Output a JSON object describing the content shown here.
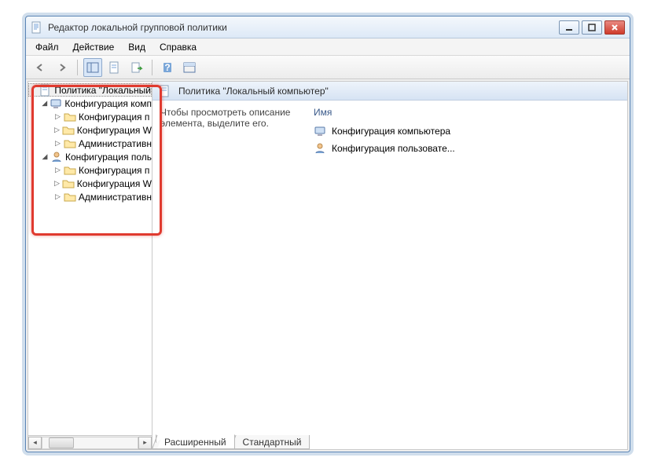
{
  "window": {
    "title": "Редактор локальной групповой политики"
  },
  "menu": {
    "file": "Файл",
    "action": "Действие",
    "view": "Вид",
    "help": "Справка"
  },
  "tree": {
    "root": "Политика \"Локальный",
    "comp_config": "Конфигурация комп",
    "comp_children": {
      "a": "Конфигурация п",
      "b": "Конфигурация W",
      "c": "Административн"
    },
    "user_config": "Конфигурация поль",
    "user_children": {
      "a": "Конфигурация п",
      "b": "Конфигурация W",
      "c": "Административн"
    }
  },
  "header": {
    "title": "Политика \"Локальный компьютер\""
  },
  "description": "Чтобы просмотреть описание элемента, выделите его.",
  "columns": {
    "name": "Имя"
  },
  "items": {
    "a": "Конфигурация компьютера",
    "b": "Конфигурация пользовате..."
  },
  "tabs": {
    "extended": "Расширенный",
    "standard": "Стандартный"
  }
}
